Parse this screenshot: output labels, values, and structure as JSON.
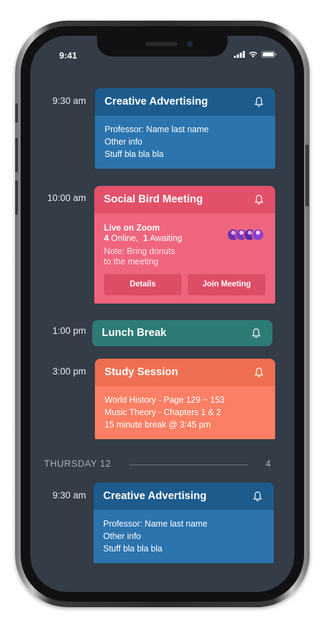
{
  "status_bar": {
    "time": "9:41"
  },
  "events": [
    {
      "time": "9:30 am",
      "title": "Creative Advertising",
      "lines": [
        "Professor: Name last name",
        "Other info",
        "Stuff bla bla bla"
      ]
    },
    {
      "time": "10:00 am",
      "title": "Social Bird Meeting",
      "live": "Live on  Zoom",
      "online_count": "4",
      "online_label": " Online,",
      "awaiting_count": "1",
      "awaiting_label": " Awaiting",
      "note_line1": "Note: Bring donuts",
      "note_line2": "to the meeting",
      "details_label": "Details",
      "join_label": "Join Meeting"
    },
    {
      "time": "1:00 pm",
      "title": "Lunch Break"
    },
    {
      "time": "3:00 pm",
      "title": "Study Session",
      "lines": [
        "World History - Page 129 ~ 153",
        "Music Theory - Chapters 1 & 2",
        "15 minute break @ 3:45 pm"
      ]
    }
  ],
  "day_divider": {
    "label": "THURSDAY 12",
    "count": "4"
  },
  "events_thursday": [
    {
      "time": "9:30 am",
      "title": "Creative Advertising",
      "lines": [
        "Professor: Name last name",
        "Other info",
        "Stuff bla bla bla"
      ]
    }
  ],
  "colors": {
    "background": "#333c47",
    "blue": "#2b74ae",
    "pink": "#f0657e",
    "teal": "#2d7b75",
    "orange": "#fb7f64"
  },
  "icons": {
    "bell": "bell-icon",
    "signal": "signal-icon",
    "wifi": "wifi-icon",
    "battery": "battery-icon"
  }
}
